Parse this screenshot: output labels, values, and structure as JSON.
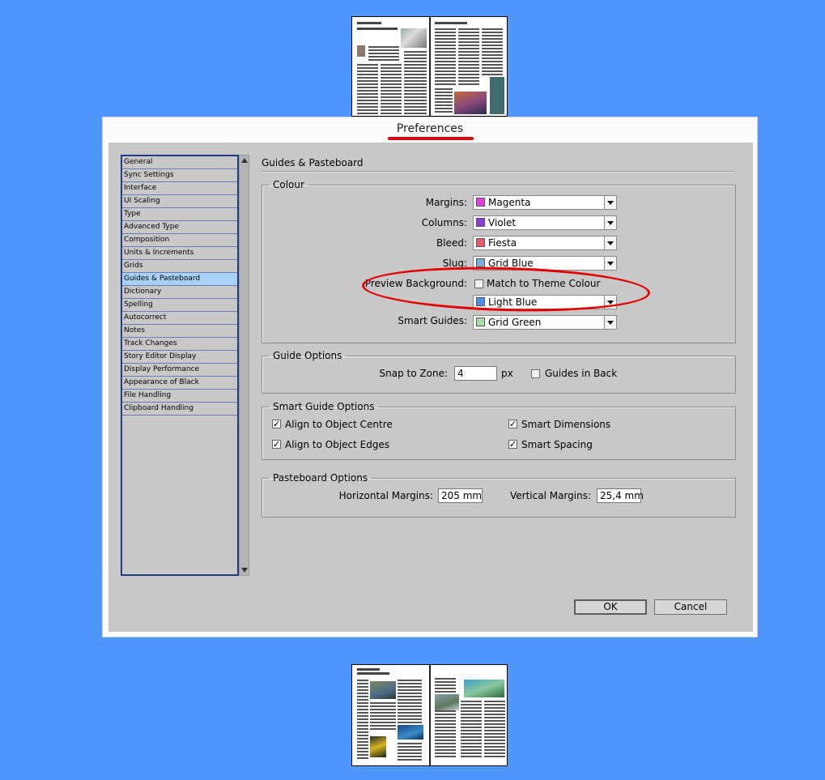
{
  "dialog": {
    "title": "Preferences",
    "panel_title": "Guides & Pasteboard"
  },
  "categories": [
    {
      "label": "General"
    },
    {
      "label": "Sync Settings"
    },
    {
      "label": "Interface"
    },
    {
      "label": "UI Scaling"
    },
    {
      "label": "Type"
    },
    {
      "label": "Advanced Type"
    },
    {
      "label": "Composition"
    },
    {
      "label": "Units & Increments"
    },
    {
      "label": "Grids"
    },
    {
      "label": "Guides & Pasteboard",
      "selected": true
    },
    {
      "label": "Dictionary"
    },
    {
      "label": "Spelling"
    },
    {
      "label": "Autocorrect"
    },
    {
      "label": "Notes"
    },
    {
      "label": "Track Changes"
    },
    {
      "label": "Story Editor Display"
    },
    {
      "label": "Display Performance"
    },
    {
      "label": "Appearance of Black"
    },
    {
      "label": "File Handling"
    },
    {
      "label": "Clipboard Handling"
    }
  ],
  "colour": {
    "legend": "Colour",
    "margins": {
      "label": "Margins:",
      "value": "Magenta",
      "swatch": "#e03ee0"
    },
    "columns": {
      "label": "Columns:",
      "value": "Violet",
      "swatch": "#8a3fd8"
    },
    "bleed": {
      "label": "Bleed:",
      "value": "Fiesta",
      "swatch": "#e85a6a"
    },
    "slug": {
      "label": "Slug:",
      "value": "Grid Blue",
      "swatch": "#7ab0d8"
    },
    "preview_background": {
      "label": "Preview Background:",
      "match_theme_label": "Match to Theme Colour",
      "match_theme_checked": false,
      "value": "Light Blue",
      "swatch": "#4b8ee8"
    },
    "smart_guides": {
      "label": "Smart Guides:",
      "value": "Grid Green",
      "swatch": "#a8dca0"
    }
  },
  "guide_options": {
    "legend": "Guide Options",
    "snap_label": "Snap to Zone:",
    "snap_value": "4",
    "snap_unit": "px",
    "guides_in_back_label": "Guides in Back",
    "guides_in_back_checked": false
  },
  "smart_guide_options": {
    "legend": "Smart Guide Options",
    "align_centre": "Align to Object Centre",
    "align_edges": "Align to Object Edges",
    "smart_dimensions": "Smart Dimensions",
    "smart_spacing": "Smart Spacing",
    "check_mark": "✓"
  },
  "pasteboard_options": {
    "legend": "Pasteboard Options",
    "horizontal_label": "Horizontal Margins:",
    "horizontal_value": "205 mm",
    "vertical_label": "Vertical Margins:",
    "vertical_value": "25,4 mm"
  },
  "buttons": {
    "ok": "OK",
    "cancel": "Cancel"
  },
  "colors": {
    "pasteboard": "#4f96fd",
    "annotation": "#e20000",
    "selection": "#a9d1f7"
  }
}
